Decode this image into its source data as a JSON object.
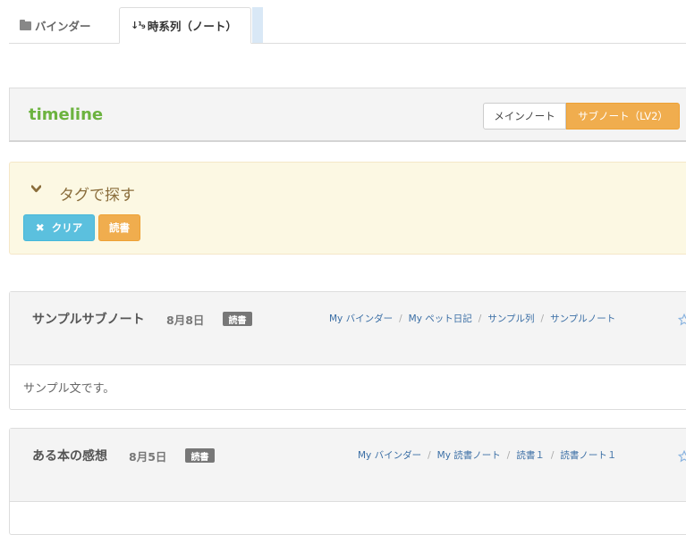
{
  "tabs": {
    "binder": "バインダー",
    "timeline": "時系列（ノート）"
  },
  "header": {
    "title": "timeline",
    "main_note": "メインノート",
    "sub_note": "サブノート（LV2）"
  },
  "tag_panel": {
    "title": "タグで探す",
    "clear": "クリア",
    "tag": "読書"
  },
  "notes": [
    {
      "title": "サンプルサブノート",
      "date": "8月8日",
      "badge": "読書",
      "breadcrumb": [
        "My バインダー",
        "My ペット日記",
        "サンプル列",
        "サンプルノート"
      ],
      "body": "サンプル文です。"
    },
    {
      "title": "ある本の感想",
      "date": "8月5日",
      "badge": "読書",
      "breadcrumb": [
        "My バインダー",
        "My 読書ノート",
        "読書１",
        "読書ノート１"
      ],
      "body": ""
    }
  ],
  "colors": {
    "accent_green": "#6cb33f",
    "warning": "#f0ad4e",
    "info": "#5bc0de",
    "link": "#3a6ea5"
  },
  "icons": {
    "binder_tab": "folder-icon",
    "timeline_tab": "sort-icon",
    "tag_title": "chevron-down-icon",
    "clear": "close-icon",
    "note": "star-icon"
  }
}
